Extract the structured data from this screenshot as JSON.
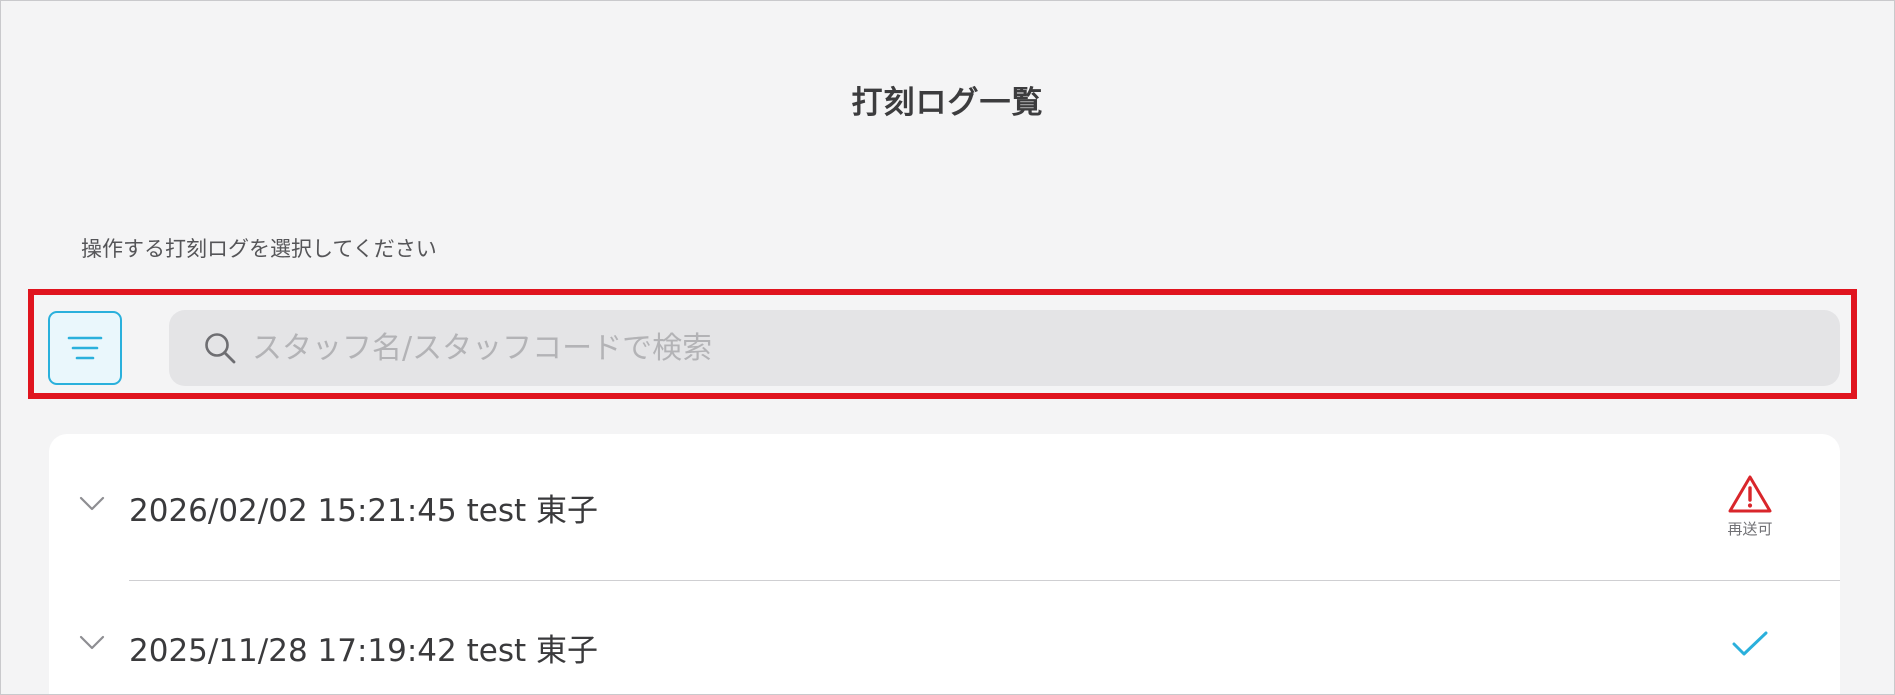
{
  "header": {
    "title": "打刻ログ一覧"
  },
  "instruction": "操作する打刻ログを選択してください",
  "toolbar": {
    "filter_icon": "filter-lines-icon",
    "search": {
      "placeholder": "スタッフ名/スタッフコードで検索",
      "value": "",
      "icon": "search-icon"
    }
  },
  "logs": [
    {
      "text": "2026/02/02 15:21:45 test 東子",
      "status": "warning",
      "status_icon": "warning-triangle-icon",
      "status_label": "再送可",
      "status_color": "#d9262b"
    },
    {
      "text": "2025/11/28 17:19:42 test 東子",
      "status": "sent",
      "status_icon": "checkmark-icon",
      "status_color": "#2ab0dc"
    }
  ],
  "colors": {
    "accent": "#2ab0dc",
    "highlight": "#e0141e",
    "background": "#f4f4f5"
  }
}
